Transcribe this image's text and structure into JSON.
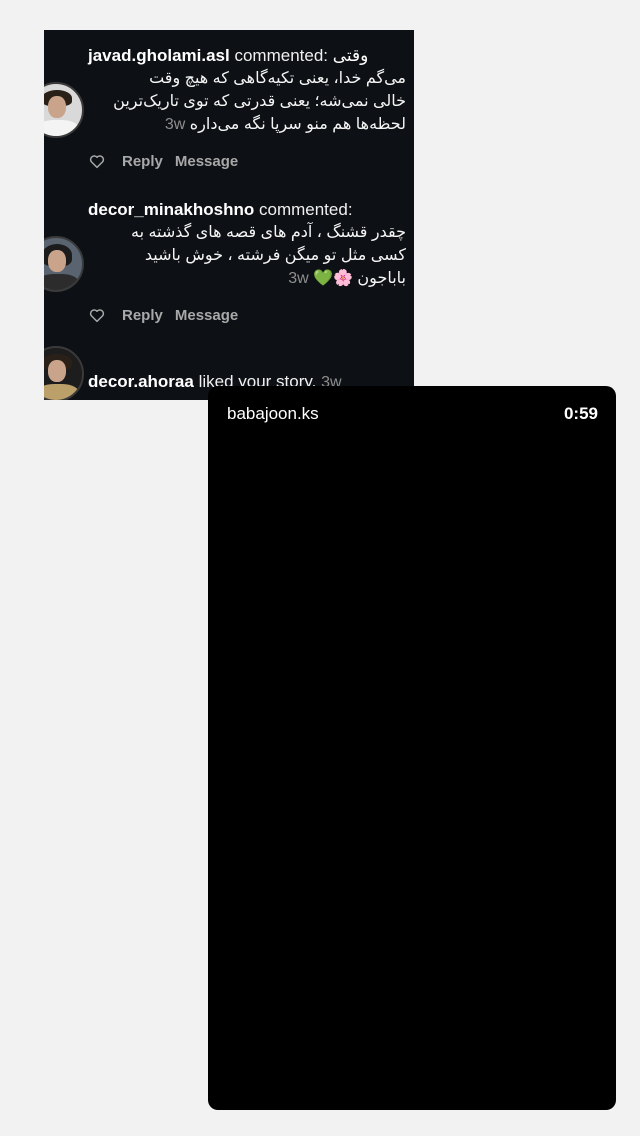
{
  "notifications": [
    {
      "username": "javad.gholami.asl",
      "verb": "commented:",
      "first_word": "وقتی",
      "lines": [
        "می‌گم خدا، یعنی تکیه‌گاهی که هیچ وقت",
        "خالی نمی‌شه؛ یعنی قدرتی که توی تاریک‌ترین",
        "لحظه‌ها هم منو سرپا نگه می‌داره"
      ],
      "time": "3w",
      "reply_label": "Reply",
      "message_label": "Message"
    },
    {
      "username": "decor_minakhoshno",
      "verb": "commented:",
      "lines": [
        "چقدر قشنگ ، آدم های قصه های گذشته به",
        "کسی مثل تو میگن فرشته ، خوش باشید",
        "باباجون 🌸💚"
      ],
      "time": "3w",
      "reply_label": "Reply",
      "message_label": "Message"
    },
    {
      "username": "decor.ahoraa",
      "verb": "liked your story.",
      "time": "3w"
    }
  ],
  "story": {
    "username": "babajoon.ks",
    "duration": "0:59"
  },
  "colors": {
    "notif_bg": "#0d1014",
    "secondary_text": "#a8a8a8",
    "timestamp": "#8e8e8e",
    "page_bg": "#f2f2f2",
    "story_bg": "#000000"
  },
  "icons": [
    "heart-icon",
    "avatar"
  ]
}
